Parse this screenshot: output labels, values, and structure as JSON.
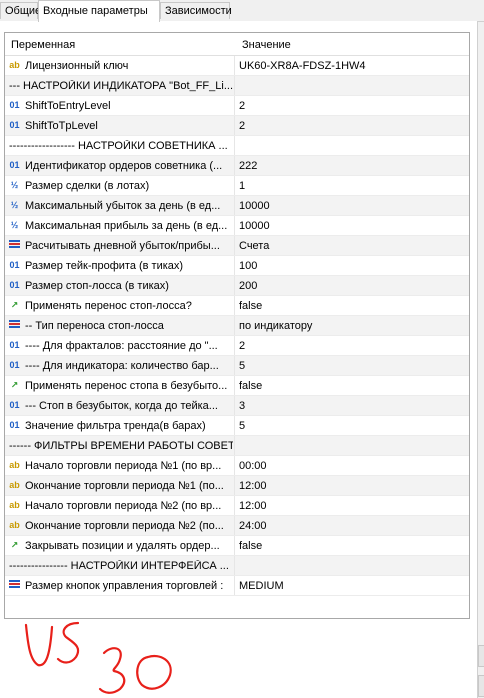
{
  "tabs": [
    "Общие",
    "Входные параметры",
    "Зависимости"
  ],
  "active_tab": 1,
  "columns": {
    "name": "Переменная",
    "value": "Значение"
  },
  "rows": [
    {
      "icon": "ab",
      "name": "Лицензионный ключ",
      "value": "UK60-XR8A-FDSZ-1HW4"
    },
    {
      "icon": "none",
      "name": "---  НАСТРОЙКИ ИНДИКАТОРА \"Bot_FF_Li...",
      "value": ""
    },
    {
      "icon": "01",
      "name": "ShiftToEntryLevel",
      "value": "2"
    },
    {
      "icon": "01",
      "name": "ShiftToTpLevel",
      "value": "2"
    },
    {
      "icon": "none",
      "name": "------------------  НАСТРОЙКИ СОВЕТНИКА ...",
      "value": ""
    },
    {
      "icon": "01",
      "name": "Идентификатор ордеров советника (...",
      "value": "222"
    },
    {
      "icon": "half",
      "name": "Размер сделки (в лотах)",
      "value": "1"
    },
    {
      "icon": "half",
      "name": "Максимальный убыток за день (в ед...",
      "value": "10000"
    },
    {
      "icon": "half",
      "name": "Максимальная прибыль за день (в ед...",
      "value": "10000"
    },
    {
      "icon": "enum",
      "name": "Расчитывать дневной убыток/прибы...",
      "value": "Счета"
    },
    {
      "icon": "01",
      "name": "Размер тейк-профита (в тиках)",
      "value": "100"
    },
    {
      "icon": "01",
      "name": "Размер стоп-лосса (в тиках)",
      "value": "200"
    },
    {
      "icon": "bool",
      "name": "Применять перенос стоп-лосса?",
      "value": "false"
    },
    {
      "icon": "enum",
      "name": "-- Тип переноса стоп-лосса",
      "value": "по индикатору"
    },
    {
      "icon": "01",
      "name": "---- Для фракталов: расстояние до \"...",
      "value": "2"
    },
    {
      "icon": "01",
      "name": "---- Для индикатора: количество бар...",
      "value": "5"
    },
    {
      "icon": "bool",
      "name": "Применять перенос стопа в безубыто...",
      "value": "false"
    },
    {
      "icon": "01",
      "name": "--- Стоп в безубыток, когда до тейка...",
      "value": "3"
    },
    {
      "icon": "01",
      "name": "Значение фильтра тренда(в барах)",
      "value": "5"
    },
    {
      "icon": "none",
      "name": "------  ФИЛЬТРЫ ВРЕМЕНИ РАБОТЫ СОВЕТ...",
      "value": ""
    },
    {
      "icon": "ab",
      "name": "Начало торговли периода №1 (по вр...",
      "value": "00:00"
    },
    {
      "icon": "ab",
      "name": "Окончание торговли периода №1 (по...",
      "value": "12:00"
    },
    {
      "icon": "ab",
      "name": "Начало торговли периода №2 (по вр...",
      "value": "12:00"
    },
    {
      "icon": "ab",
      "name": "Окончание торговли периода №2 (по...",
      "value": "24:00"
    },
    {
      "icon": "bool",
      "name": "Закрывать позиции и удалять ордер...",
      "value": "false"
    },
    {
      "icon": "none",
      "name": "----------------  НАСТРОЙКИ ИНТЕРФЕЙСА ...",
      "value": ""
    },
    {
      "icon": "enum",
      "name": "Размер кнопок управления торговлей :",
      "value": "MEDIUM"
    }
  ],
  "annotation": "US 30",
  "colors": {
    "annotation": "#e8201a",
    "icon_ab": "#c89a00",
    "icon_num": "#1f5fc5",
    "icon_bool": "#2f9a2f"
  }
}
